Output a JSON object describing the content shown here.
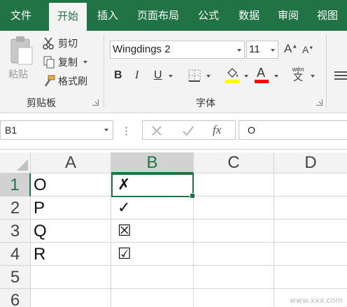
{
  "tabs": [
    {
      "label": "文件",
      "active": false
    },
    {
      "label": "开始",
      "active": true
    },
    {
      "label": "插入",
      "active": false
    },
    {
      "label": "页面布局",
      "active": false
    },
    {
      "label": "公式",
      "active": false
    },
    {
      "label": "数据",
      "active": false
    },
    {
      "label": "审阅",
      "active": false
    },
    {
      "label": "视图",
      "active": false
    }
  ],
  "clipboard": {
    "paste_label": "粘贴",
    "cut_label": "剪切",
    "copy_label": "复制",
    "format_painter_label": "格式刷",
    "group_label": "剪贴板"
  },
  "font": {
    "font_name": "Wingdings 2",
    "font_size": "11",
    "grow_label": "A",
    "shrink_label": "A",
    "bold_label": "B",
    "italic_label": "I",
    "underline_label": "U",
    "font_color_label": "A",
    "phonetic_top": "wén",
    "phonetic_char": "文",
    "group_label": "字体",
    "fill_color": "#ffff00",
    "font_color": "#ff0000"
  },
  "formula_bar": {
    "name_box": "B1",
    "fx_label": "fx",
    "content": "O"
  },
  "columns": [
    "A",
    "B",
    "C",
    "D"
  ],
  "rows": [
    {
      "num": "1",
      "a": "O",
      "b": "✗"
    },
    {
      "num": "2",
      "a": "P",
      "b": "✓"
    },
    {
      "num": "3",
      "a": "Q",
      "b": "☒"
    },
    {
      "num": "4",
      "a": "R",
      "b": "☑"
    },
    {
      "num": "5",
      "a": "",
      "b": ""
    },
    {
      "num": "6",
      "a": "",
      "b": ""
    }
  ],
  "selected_cell": "B1",
  "watermark": "www.xxx.com",
  "accent_color": "#217346"
}
